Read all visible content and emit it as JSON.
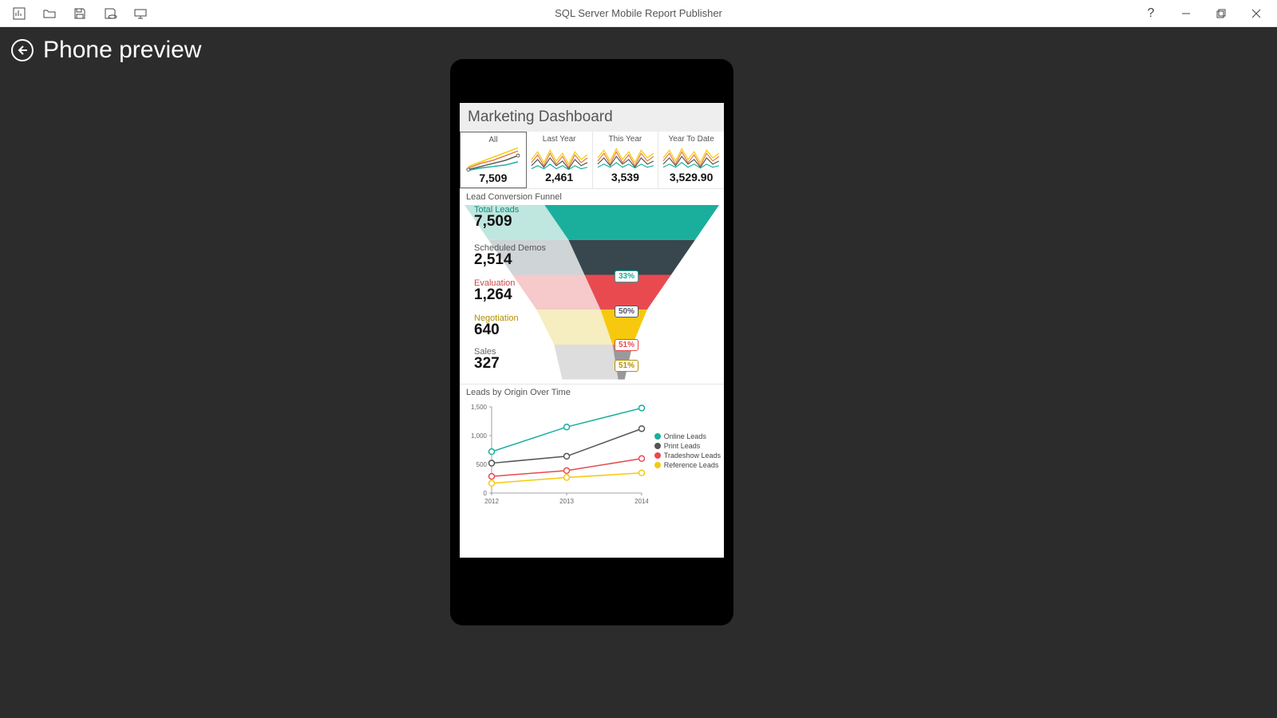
{
  "app": {
    "title": "SQL Server Mobile Report Publisher"
  },
  "page": {
    "title": "Phone preview"
  },
  "dashboard": {
    "title": "Marketing Dashboard",
    "kpis": [
      {
        "label": "All",
        "value": "7,509",
        "selected": true
      },
      {
        "label": "Last Year",
        "value": "2,461"
      },
      {
        "label": "This Year",
        "value": "3,539"
      },
      {
        "label": "Year To Date",
        "value": "3,529.90"
      }
    ],
    "funnel": {
      "title": "Lead Conversion Funnel",
      "stages": [
        {
          "label": "Total Leads",
          "value": "7,509",
          "color": "#1aaf9c",
          "label_color": "#0f8c7c"
        },
        {
          "label": "Scheduled Demos",
          "value": "2,514",
          "color": "#38464e",
          "label_color": "#555",
          "pct": "33%",
          "pct_color": "#1aaf9c"
        },
        {
          "label": "Evaluation",
          "value": "1,264",
          "color": "#e84a50",
          "label_color": "#d14747",
          "pct": "50%",
          "pct_color": "#556"
        },
        {
          "label": "Negotiation",
          "value": "640",
          "color": "#f6c90e",
          "label_color": "#b38f00",
          "pct": "51%",
          "pct_color": "#e84a50"
        },
        {
          "label": "Sales",
          "value": "327",
          "color": "#999",
          "label_color": "#666",
          "pct": "51%",
          "pct_color": "#b38f00"
        }
      ]
    },
    "line_chart": {
      "title": "Leads by Origin Over Time",
      "legend": [
        "Online Leads",
        "Print Leads",
        "Tradeshow Leads",
        "Reference Leads"
      ]
    }
  },
  "chart_data": [
    {
      "type": "line",
      "title": "Leads by Origin Over Time",
      "x": [
        "2012",
        "2013",
        "2014"
      ],
      "xlabel": "",
      "ylabel": "",
      "ylim": [
        0,
        1500
      ],
      "yticks": [
        0,
        500,
        1000,
        1500
      ],
      "series": [
        {
          "name": "Online Leads",
          "color": "#1aaf9c",
          "values": [
            720,
            1150,
            1480
          ]
        },
        {
          "name": "Print Leads",
          "color": "#555",
          "values": [
            520,
            640,
            1120
          ]
        },
        {
          "name": "Tradeshow Leads",
          "color": "#e84a50",
          "values": [
            290,
            390,
            600
          ]
        },
        {
          "name": "Reference Leads",
          "color": "#f6c90e",
          "values": [
            170,
            270,
            350
          ]
        }
      ]
    },
    {
      "type": "funnel",
      "title": "Lead Conversion Funnel",
      "categories": [
        "Total Leads",
        "Scheduled Demos",
        "Evaluation",
        "Negotiation",
        "Sales"
      ],
      "values": [
        7509,
        2514,
        1264,
        640,
        327
      ],
      "conversion_pct": [
        null,
        33,
        50,
        51,
        51
      ]
    }
  ]
}
